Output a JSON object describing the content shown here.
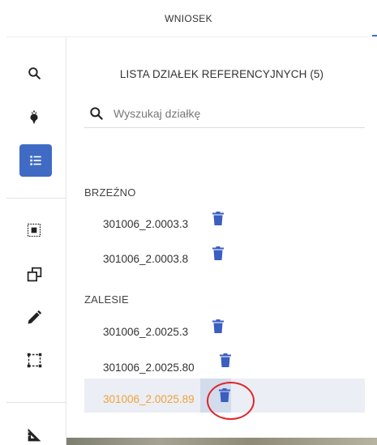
{
  "top_tab": {
    "label": "WNIOSEK"
  },
  "rail": {
    "items": [
      {
        "name": "search",
        "icon": "search-icon"
      },
      {
        "name": "crops",
        "icon": "beet-icon"
      },
      {
        "name": "parcel-list",
        "icon": "list-icon",
        "active": true
      },
      {
        "name": "select-area",
        "icon": "select-area-icon"
      },
      {
        "name": "copy",
        "icon": "copy-icon"
      },
      {
        "name": "draw",
        "icon": "pencil-icon"
      },
      {
        "name": "vertex-edit",
        "icon": "vertex-frame-icon"
      },
      {
        "name": "measure",
        "icon": "ruler-triangle-icon"
      }
    ]
  },
  "panel": {
    "title": "LISTA DZIAŁEK REFERENCYJNYCH (5)",
    "search": {
      "placeholder": "Wyszukaj działkę",
      "value": ""
    },
    "groups": [
      {
        "label": "BRZEŹNO",
        "parcels": [
          {
            "id": "301006_2.0003.3"
          },
          {
            "id": "301006_2.0003.8"
          }
        ]
      },
      {
        "label": "ZALESIE",
        "parcels": [
          {
            "id": "301006_2.0025.3"
          },
          {
            "id": "301006_2.0025.80"
          },
          {
            "id": "301006_2.0025.89",
            "selected": true
          }
        ]
      }
    ]
  },
  "colors": {
    "accent": "#3f6bc4",
    "icon_blue": "#3b5ec0",
    "selected_text": "#f0a23a",
    "selected_bg": "#ebeef4",
    "annotation_red": "#e0262b"
  }
}
